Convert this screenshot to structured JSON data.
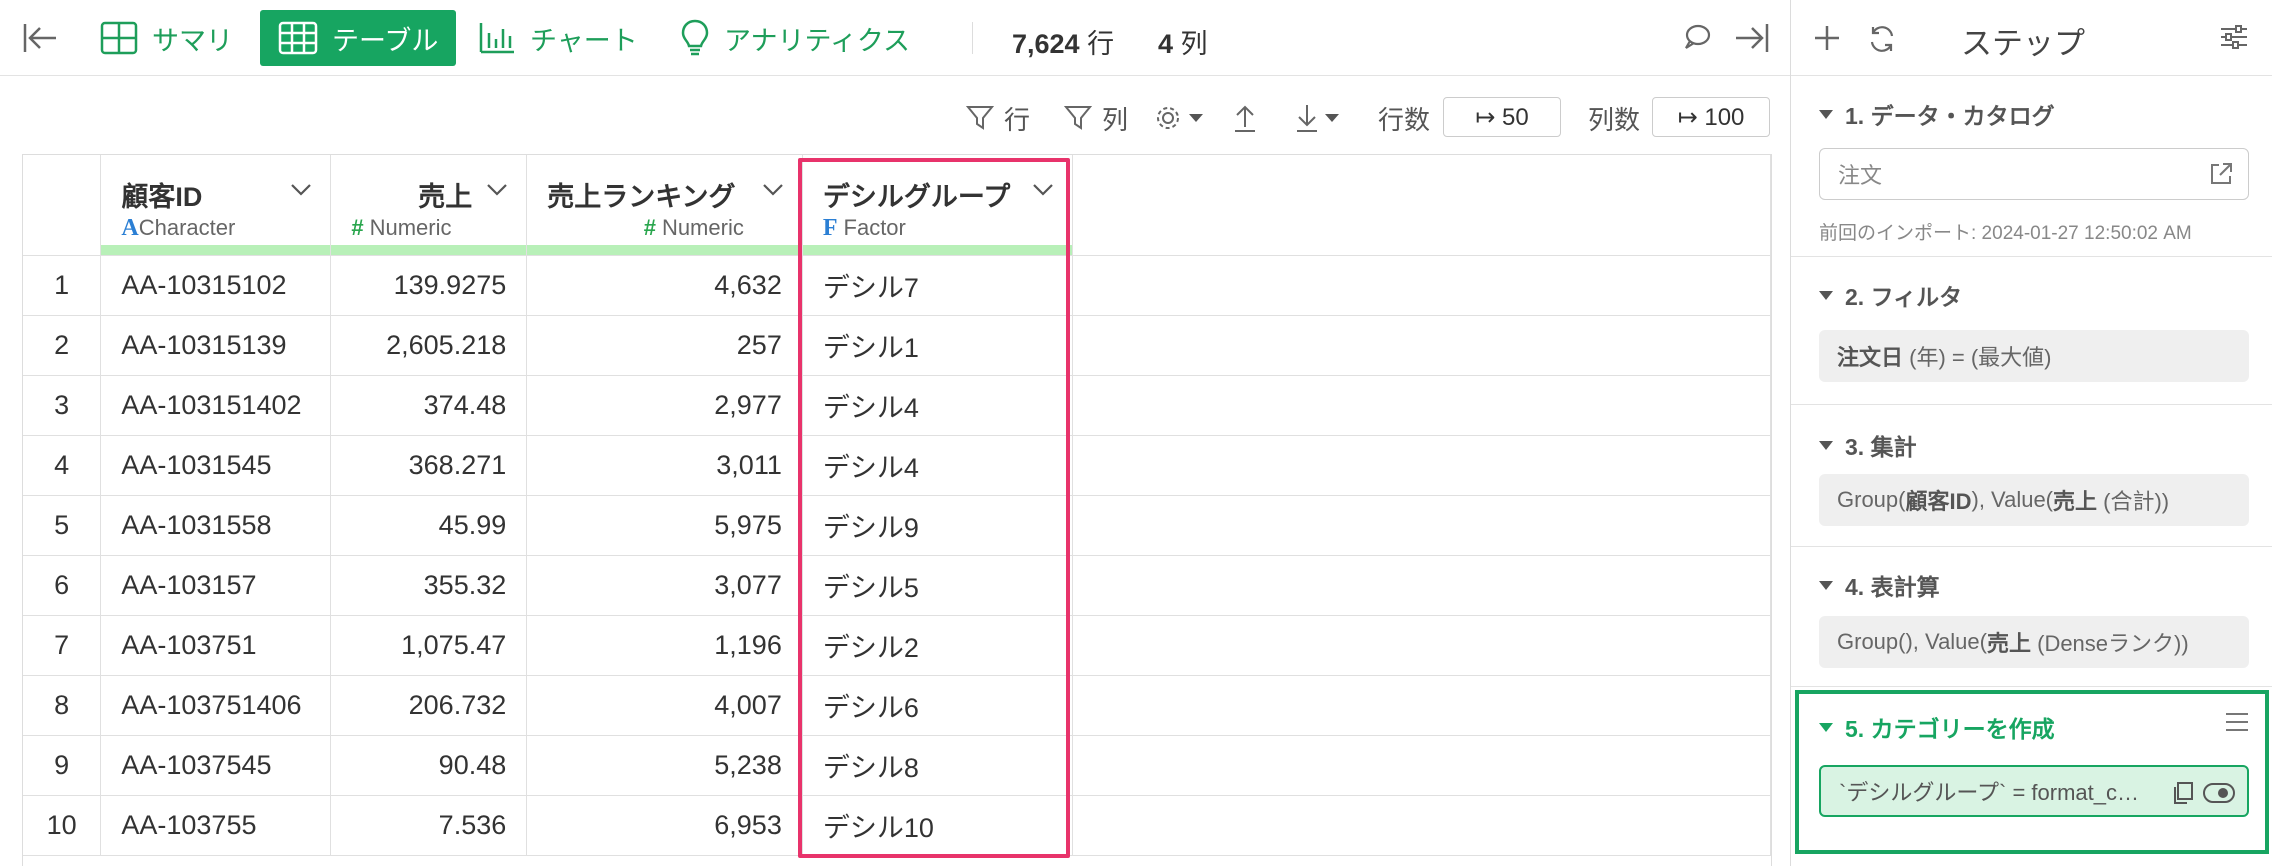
{
  "toolbar": {
    "summary_label": "サマリ",
    "table_label": "テーブル",
    "chart_label": "チャート",
    "analytics_label": "アナリティクス",
    "rows_count": "7,624",
    "rows_unit": "行",
    "cols_count": "4",
    "cols_unit": "列"
  },
  "grid_toolbar": {
    "row_filter_label": "行",
    "col_filter_label": "列",
    "rows_label": "行数",
    "rows_value": "↦ 50",
    "cols_label": "列数",
    "cols_value": "↦ 100"
  },
  "table": {
    "columns": [
      {
        "name": "顧客ID",
        "type_icon": "A",
        "type": "Character"
      },
      {
        "name": "売上",
        "type_icon": "#",
        "type": "Numeric"
      },
      {
        "name": "売上ランキング",
        "type_icon": "#",
        "type": "Numeric"
      },
      {
        "name": "デシルグループ",
        "type_icon": "F",
        "type": "Factor"
      }
    ],
    "rows": [
      {
        "idx": "1",
        "id": "AA-10315102",
        "sales": "139.9275",
        "rank": "4,632",
        "group": "デシル7"
      },
      {
        "idx": "2",
        "id": "AA-10315139",
        "sales": "2,605.218",
        "rank": "257",
        "group": "デシル1"
      },
      {
        "idx": "3",
        "id": "AA-103151402",
        "sales": "374.48",
        "rank": "2,977",
        "group": "デシル4"
      },
      {
        "idx": "4",
        "id": "AA-1031545",
        "sales": "368.271",
        "rank": "3,011",
        "group": "デシル4"
      },
      {
        "idx": "5",
        "id": "AA-1031558",
        "sales": "45.99",
        "rank": "5,975",
        "group": "デシル9"
      },
      {
        "idx": "6",
        "id": "AA-103157",
        "sales": "355.32",
        "rank": "3,077",
        "group": "デシル5"
      },
      {
        "idx": "7",
        "id": "AA-103751",
        "sales": "1,075.47",
        "rank": "1,196",
        "group": "デシル2"
      },
      {
        "idx": "8",
        "id": "AA-103751406",
        "sales": "206.732",
        "rank": "4,007",
        "group": "デシル6"
      },
      {
        "idx": "9",
        "id": "AA-1037545",
        "sales": "90.48",
        "rank": "5,238",
        "group": "デシル8"
      },
      {
        "idx": "10",
        "id": "AA-103755",
        "sales": "7.536",
        "rank": "6,953",
        "group": "デシル10"
      }
    ]
  },
  "panel": {
    "title": "ステップ",
    "steps": [
      {
        "title": "1. データ・カタログ",
        "input_value": "注文",
        "note": "前回のインポート: 2024-01-27 12:50:02 AM"
      },
      {
        "title": "2. フィルタ",
        "box_bold": "注文日",
        "box_text": " (年) = (最大値)"
      },
      {
        "title": "3. 集計",
        "box_prefix": "Group(",
        "box_b1": "顧客ID",
        "box_mid": "), Value(",
        "box_b2": "売上",
        "box_suffix": " (合計))"
      },
      {
        "title": "4. 表計算",
        "box_prefix": "Group(), Value(",
        "box_b1": "売上",
        "box_suffix": " (Denseランク))"
      },
      {
        "title": "5. カテゴリーを作成",
        "box_text": "`デシルグループ` = format_c…"
      }
    ]
  },
  "colors": {
    "accent": "#17a561",
    "highlight": "#e8336b",
    "type_bar": "#b8f0b8"
  }
}
